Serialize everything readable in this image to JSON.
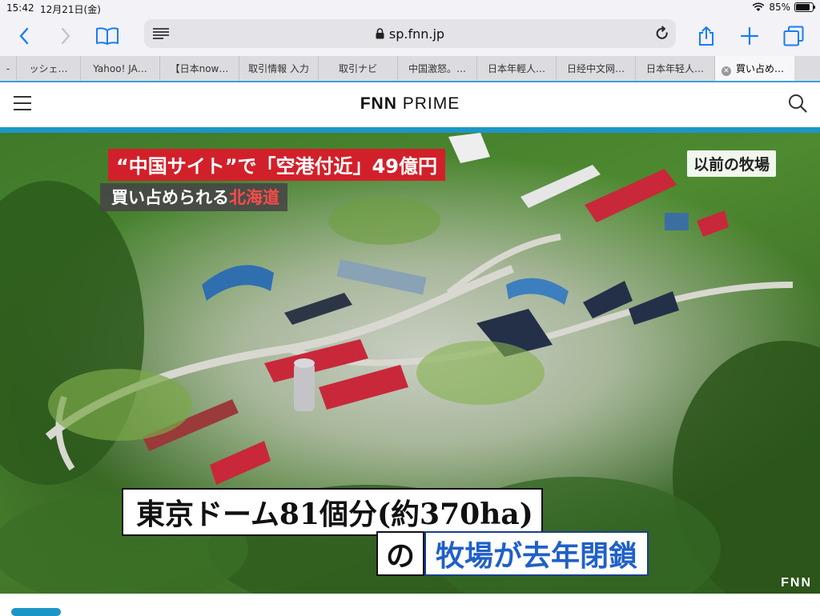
{
  "status": {
    "time": "15:42",
    "date": "12月21日(金)",
    "battery": "85%"
  },
  "toolbar": {
    "url": "sp.fnn.jp"
  },
  "tabs": [
    {
      "label": "-"
    },
    {
      "label": "ッシェ…"
    },
    {
      "label": "Yahoo! JA…"
    },
    {
      "label": "【日本now…"
    },
    {
      "label": "取引情報 入力"
    },
    {
      "label": "取引ナビ"
    },
    {
      "label": "中国激怒。…"
    },
    {
      "label": "日本年輕人…"
    },
    {
      "label": "日经中文网…"
    },
    {
      "label": "日本年轻人…"
    },
    {
      "label": "買い占め…",
      "active": true
    }
  ],
  "site": {
    "logo_part1": "FNN",
    "logo_part2": "PRIME"
  },
  "hero": {
    "caption_red": "“中国サイト”で「空港付近」49億円",
    "caption_gray_a": "買い占められる",
    "caption_gray_b": "北海道",
    "caption_tag": "以前の牧場",
    "caption_bottom1": "東京ドーム81個分(約370ha)",
    "caption_bottom2_a": "の",
    "caption_bottom2_b": "牧場が去年閉鎖",
    "watermark": "FNN"
  },
  "colors": {
    "accent": "#1a97c7",
    "caption_red": "#d2202a",
    "ios_blue": "#1a7cf5"
  }
}
